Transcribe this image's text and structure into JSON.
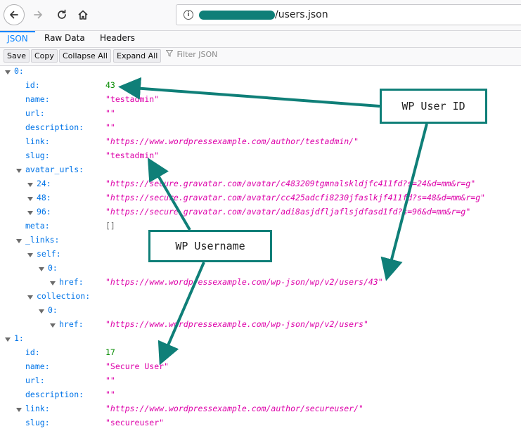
{
  "browser": {
    "url_path": "/users.json",
    "icons": {
      "back": "back-arrow-icon",
      "forward": "forward-arrow-icon",
      "reload": "reload-icon",
      "home": "home-icon",
      "site_info": "info-icon"
    }
  },
  "tabs": [
    {
      "label": "JSON",
      "active": true
    },
    {
      "label": "Raw Data",
      "active": false
    },
    {
      "label": "Headers",
      "active": false
    }
  ],
  "toolbar": {
    "save": "Save",
    "copy": "Copy",
    "collapse_all": "Collapse All",
    "expand_all": "Expand All",
    "filter_placeholder": "Filter JSON"
  },
  "tree": [
    {
      "key": "0:",
      "level": 0,
      "toggle": true
    },
    {
      "key": "id:",
      "level": 1,
      "value": "43",
      "type": "num"
    },
    {
      "key": "name:",
      "level": 1,
      "value": "\"testadmin\"",
      "type": "str"
    },
    {
      "key": "url:",
      "level": 1,
      "value": "\"\"",
      "type": "str"
    },
    {
      "key": "description:",
      "level": 1,
      "value": "\"\"",
      "type": "str"
    },
    {
      "key": "link:",
      "level": 1,
      "value": "\"https://www.wordpressexample.com/author/testadmin/\"",
      "type": "url"
    },
    {
      "key": "slug:",
      "level": 1,
      "value": "\"testadmin\"",
      "type": "str"
    },
    {
      "key": "avatar_urls:",
      "level": 1,
      "toggle": true
    },
    {
      "key": "24:",
      "level": 2,
      "toggle": true,
      "value": "\"https://secure.gravatar.com/avatar/c483209tgmnalskldjfc411fd?s=24&d=mm&r=g\"",
      "type": "url"
    },
    {
      "key": "48:",
      "level": 2,
      "toggle": true,
      "value": "\"https://secure.gravatar.com/avatar/cc425adcfi8230jfaslkjf411fd?s=48&d=mm&r=g\"",
      "type": "url"
    },
    {
      "key": "96:",
      "level": 2,
      "toggle": true,
      "value": "\"https://secure.gravatar.com/avatar/adi8asjdfljaflsjdfasd1fd?s=96&d=mm&r=g\"",
      "type": "url"
    },
    {
      "key": "meta:",
      "level": 1,
      "value": "[]",
      "type": "arr"
    },
    {
      "key": "_links:",
      "level": 1,
      "toggle": true
    },
    {
      "key": "self:",
      "level": 2,
      "toggle": true
    },
    {
      "key": "0:",
      "level": 3,
      "toggle": true
    },
    {
      "key": "href:",
      "level": 4,
      "toggle": true,
      "value": "\"https://www.wordpressexample.com/wp-json/wp/v2/users/43\"",
      "type": "url"
    },
    {
      "key": "collection:",
      "level": 2,
      "toggle": true
    },
    {
      "key": "0:",
      "level": 3,
      "toggle": true
    },
    {
      "key": "href:",
      "level": 4,
      "toggle": true,
      "value": "\"https://www.wordpressexample.com/wp-json/wp/v2/users\"",
      "type": "url"
    },
    {
      "key": "1:",
      "level": 0,
      "toggle": true
    },
    {
      "key": "id:",
      "level": 1,
      "value": "17",
      "type": "num"
    },
    {
      "key": "name:",
      "level": 1,
      "value": "\"Secure User\"",
      "type": "str"
    },
    {
      "key": "url:",
      "level": 1,
      "value": "\"\"",
      "type": "str"
    },
    {
      "key": "description:",
      "level": 1,
      "value": "\"\"",
      "type": "str"
    },
    {
      "key": "link:",
      "level": 1,
      "toggle": true,
      "value": "\"https://www.wordpressexample.com/author/secureuser/\"",
      "type": "url"
    },
    {
      "key": "slug:",
      "level": 1,
      "value": "\"secureuser\"",
      "type": "str"
    }
  ],
  "annotations": {
    "user_id_label": "WP User ID",
    "username_label": "WP Username",
    "color": "#0f7f78"
  }
}
